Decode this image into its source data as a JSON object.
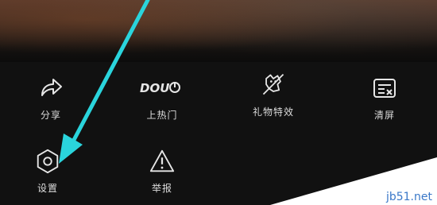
{
  "menu": {
    "row1": [
      {
        "label": "分享",
        "icon": "share-icon"
      },
      {
        "label": "上热门",
        "icon": "dou-plus-icon"
      },
      {
        "label": "礼物特效",
        "icon": "gift-effects-icon"
      },
      {
        "label": "清屏",
        "icon": "clear-screen-icon"
      }
    ],
    "row2": [
      {
        "label": "设置",
        "icon": "settings-hexagon-icon"
      },
      {
        "label": "举报",
        "icon": "report-warning-icon"
      }
    ],
    "dou_logo_text": "DOU"
  },
  "watermark": {
    "text": "jb51.net"
  },
  "colors": {
    "arrow": "#2ad4dc",
    "background": "#111111",
    "icon": "#e6e6e6"
  }
}
